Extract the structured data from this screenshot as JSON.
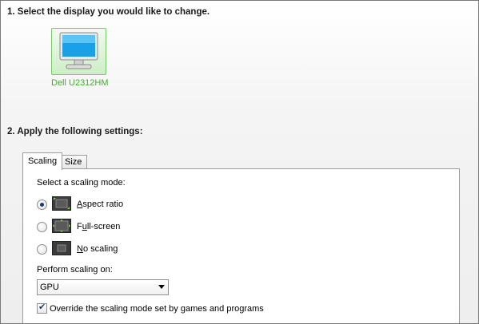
{
  "section1": {
    "title": "1. Select the display you would like to change."
  },
  "display": {
    "name": "Dell U2312HM"
  },
  "section2": {
    "title": "2. Apply the following settings:"
  },
  "tabs": [
    {
      "label": "Scaling",
      "selected": true
    },
    {
      "label": "Size",
      "selected": false
    }
  ],
  "scaling": {
    "mode_label": "Select a scaling mode:",
    "modes": [
      {
        "label_prefix": "",
        "label_underline": "A",
        "label_rest": "spect ratio",
        "selected": true,
        "icon": "aspect-ratio-icon"
      },
      {
        "label_prefix": "F",
        "label_underline": "u",
        "label_rest": "ll-screen",
        "selected": false,
        "icon": "full-screen-icon"
      },
      {
        "label_prefix": "",
        "label_underline": "N",
        "label_rest": "o scaling",
        "selected": false,
        "icon": "no-scaling-icon"
      }
    ],
    "perform_label": "Perform scaling on:",
    "perform_value": "GPU",
    "override_label": "Override the scaling mode set by games and programs",
    "override_checked": true
  },
  "colors": {
    "accent_green": "#76b900",
    "label_green": "#3fae2a"
  }
}
